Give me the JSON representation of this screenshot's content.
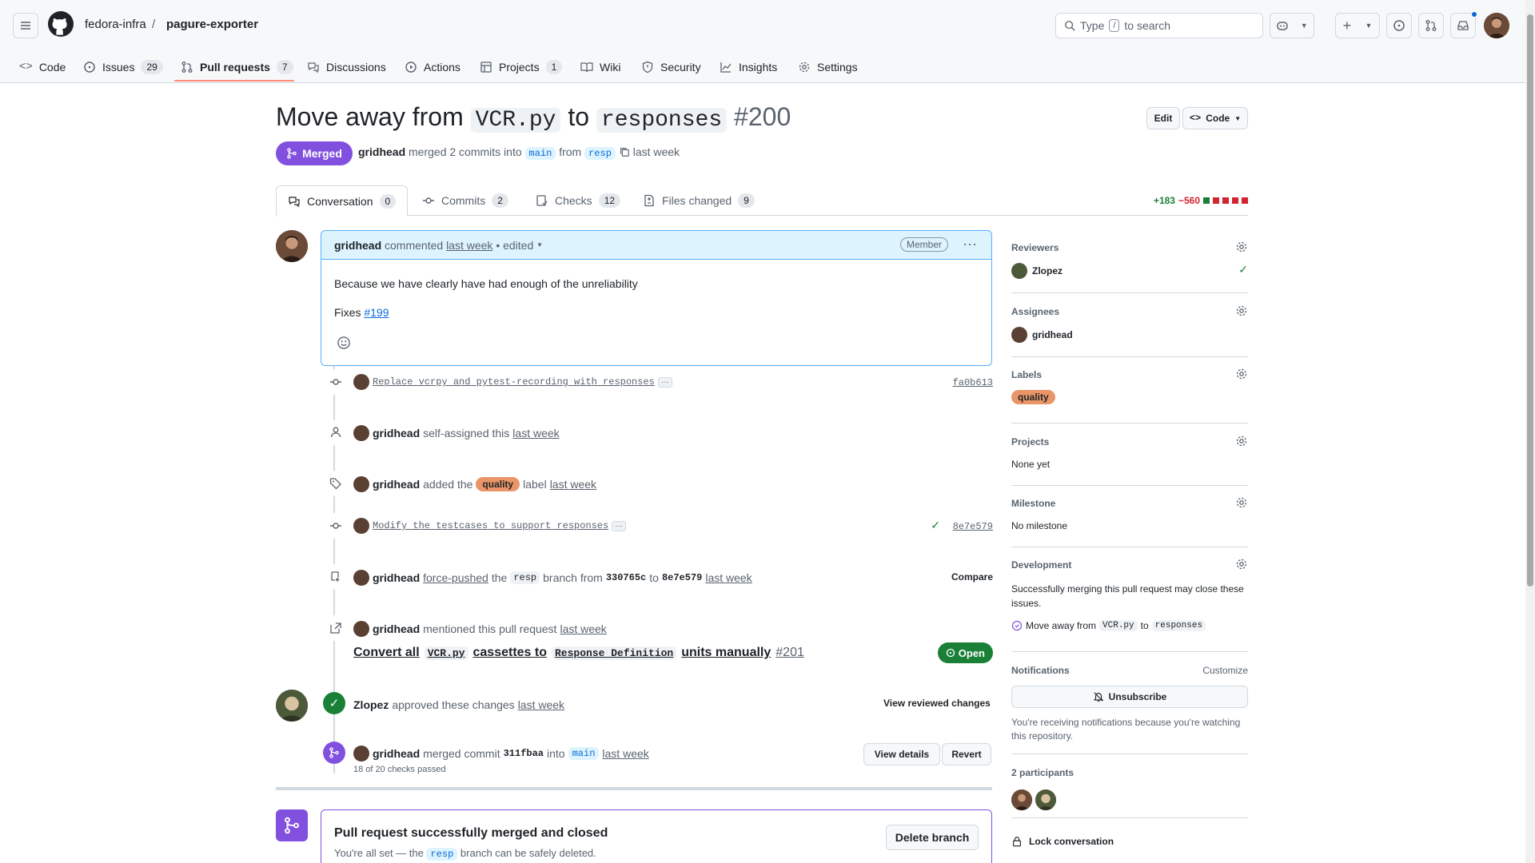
{
  "repo": {
    "owner": "fedora-infra",
    "name": "pagure-exporter"
  },
  "search": {
    "placeholder_pre": "Type",
    "key": "/",
    "placeholder_post": "to search"
  },
  "nav": {
    "code": "Code",
    "issues": "Issues",
    "issues_count": "29",
    "pulls": "Pull requests",
    "pulls_count": "7",
    "discussions": "Discussions",
    "actions": "Actions",
    "projects": "Projects",
    "projects_count": "1",
    "wiki": "Wiki",
    "security": "Security",
    "insights": "Insights",
    "settings": "Settings"
  },
  "pr": {
    "title_pre": "Move away from",
    "title_code1": "VCR.py",
    "title_mid": "to",
    "title_code2": "responses",
    "number": "#200",
    "status": "Merged",
    "author": "gridhead",
    "meta_text": "merged 2 commits into",
    "base": "main",
    "from": "from",
    "head": "resp",
    "when": "last week",
    "edit": "Edit",
    "code_btn": "Code"
  },
  "tabs": {
    "conversation": "Conversation",
    "conversation_count": "0",
    "commits": "Commits",
    "commits_count": "2",
    "checks": "Checks",
    "checks_count": "12",
    "files": "Files changed",
    "files_count": "9",
    "additions": "+183",
    "deletions": "−560"
  },
  "comment": {
    "author": "gridhead",
    "action": "commented",
    "when": "last week",
    "edited": "• edited",
    "role": "Member",
    "body1": "Because we have clearly have had enough of the unreliability",
    "fixes": "Fixes",
    "fixes_link": "#199"
  },
  "timeline": {
    "commit1_msg": "Replace vcrpy and pytest-recording with responses",
    "commit1_sha": "fa0b613",
    "assign_user": "gridhead",
    "assign_text": "self-assigned this",
    "assign_when": "last week",
    "label_user": "gridhead",
    "label_pre": "added the",
    "label_name": "quality",
    "label_post": "label",
    "label_when": "last week",
    "commit2_msg": "Modify the testcases to support responses",
    "commit2_sha": "8e7e579",
    "fp_user": "gridhead",
    "fp_action": "force-pushed",
    "fp_the": "the",
    "fp_branch": "resp",
    "fp_from": "branch from",
    "fp_old": "330765c",
    "fp_to": "to",
    "fp_new": "8e7e579",
    "fp_when": "last week",
    "fp_compare": "Compare",
    "mention_user": "gridhead",
    "mention_text": "mentioned this pull request",
    "mention_when": "last week",
    "ref_pre": "Convert all",
    "ref_code1": "VCR.py",
    "ref_mid": "cassettes to",
    "ref_code2": "Response Definition",
    "ref_post": "units manually",
    "ref_num": "#201",
    "ref_status": "Open",
    "approve_user": "Zlopez",
    "approve_text": "approved these changes",
    "approve_when": "last week",
    "approve_btn": "View reviewed changes",
    "merge_user": "gridhead",
    "merge_text": "merged commit",
    "merge_sha": "311fbaa",
    "merge_into": "into",
    "merge_branch": "main",
    "merge_when": "last week",
    "merge_checks": "18 of 20 checks passed",
    "view_details": "View details",
    "revert": "Revert"
  },
  "mergebox": {
    "title": "Pull request successfully merged and closed",
    "sub_pre": "You're all set — the",
    "sub_branch": "resp",
    "sub_post": "branch can be safely deleted.",
    "delete_btn": "Delete branch"
  },
  "sidebar": {
    "reviewers_title": "Reviewers",
    "reviewer": "Zlopez",
    "assignees_title": "Assignees",
    "assignee": "gridhead",
    "labels_title": "Labels",
    "label": "quality",
    "projects_title": "Projects",
    "projects_value": "None yet",
    "milestone_title": "Milestone",
    "milestone_value": "No milestone",
    "development_title": "Development",
    "development_text": "Successfully merging this pull request may close these issues.",
    "dev_issue_pre": "Move away from",
    "dev_issue_code1": "VCR.py",
    "dev_issue_mid": "to",
    "dev_issue_code2": "responses",
    "notifications_title": "Notifications",
    "customize": "Customize",
    "unsubscribe": "Unsubscribe",
    "notif_text": "You're receiving notifications because you're watching this repository.",
    "participants": "2 participants",
    "lock": "Lock conversation"
  },
  "colors": {
    "merged": "#8250df",
    "open": "#1a7f37",
    "label_quality": "#e99567",
    "accent": "#0969da"
  }
}
